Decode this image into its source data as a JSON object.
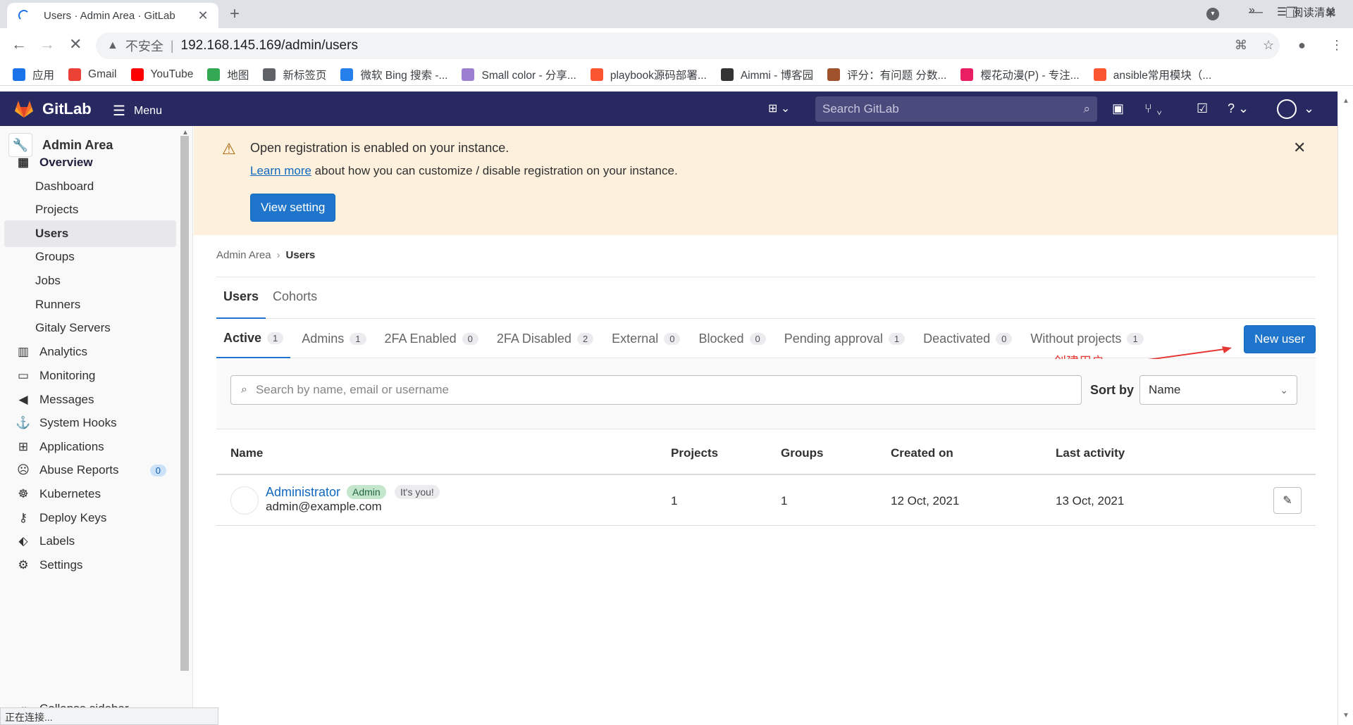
{
  "browser": {
    "tab_title": "Users · Admin Area · GitLab",
    "address_warning": "不安全",
    "url": "192.168.145.169/admin/users",
    "bookmarks": [
      {
        "label": "应用",
        "icon": "apps-grid-icon",
        "color": "#1a73e8"
      },
      {
        "label": "Gmail",
        "icon": "gmail-icon",
        "color": "#ea4335"
      },
      {
        "label": "YouTube",
        "icon": "youtube-icon",
        "color": "#ff0000"
      },
      {
        "label": "地图",
        "icon": "maps-icon",
        "color": "#34a853"
      },
      {
        "label": "新标签页",
        "icon": "globe-icon",
        "color": "#5f6368"
      },
      {
        "label": "微软 Bing 搜索 -...",
        "icon": "bing-icon",
        "color": "#2680eb"
      },
      {
        "label": "Small color - 分享...",
        "icon": "smallcolor-icon",
        "color": "#9c7fd1"
      },
      {
        "label": "playbook源码部署...",
        "icon": "csdn-icon",
        "color": "#fc5531"
      },
      {
        "label": "Aimmi - 博客园",
        "icon": "blog-icon",
        "color": "#333333"
      },
      {
        "label": "评分：有问题 分数...",
        "icon": "avatar-icon",
        "color": "#a0522d"
      },
      {
        "label": "樱花动漫(P) - 专注...",
        "icon": "flower-icon",
        "color": "#e91e63"
      },
      {
        "label": "ansible常用模块（...",
        "icon": "csdn-icon",
        "color": "#fc5531"
      }
    ],
    "bookmarks_more": "»",
    "reading_list": "阅读清单",
    "status_text": "正在连接..."
  },
  "header": {
    "brand": "GitLab",
    "menu_label": "Menu",
    "search_placeholder": "Search GitLab"
  },
  "sidebar": {
    "title": "Admin Area",
    "items": [
      {
        "label": "Overview",
        "icon": "overview-grid-icon",
        "kind": "group"
      },
      {
        "label": "Dashboard",
        "kind": "sub"
      },
      {
        "label": "Projects",
        "kind": "sub"
      },
      {
        "label": "Users",
        "kind": "sub-active"
      },
      {
        "label": "Groups",
        "kind": "sub"
      },
      {
        "label": "Jobs",
        "kind": "sub"
      },
      {
        "label": "Runners",
        "kind": "sub"
      },
      {
        "label": "Gitaly Servers",
        "kind": "sub"
      },
      {
        "label": "Analytics",
        "icon": "chart-icon",
        "kind": "item"
      },
      {
        "label": "Monitoring",
        "icon": "monitor-icon",
        "kind": "item"
      },
      {
        "label": "Messages",
        "icon": "megaphone-icon",
        "kind": "item"
      },
      {
        "label": "System Hooks",
        "icon": "hook-icon",
        "kind": "item"
      },
      {
        "label": "Applications",
        "icon": "applications-icon",
        "kind": "item"
      },
      {
        "label": "Abuse Reports",
        "icon": "abuse-icon",
        "kind": "item",
        "badge": "0"
      },
      {
        "label": "Kubernetes",
        "icon": "kubernetes-icon",
        "kind": "item"
      },
      {
        "label": "Deploy Keys",
        "icon": "key-icon",
        "kind": "item"
      },
      {
        "label": "Labels",
        "icon": "label-icon",
        "kind": "item"
      },
      {
        "label": "Settings",
        "icon": "settings-icon",
        "kind": "item"
      }
    ],
    "collapse_label": "Collapse sidebar"
  },
  "alert": {
    "title": "Open registration is enabled on your instance.",
    "link_text": "Learn more",
    "body": " about how you can customize / disable registration on your instance.",
    "button": "View setting"
  },
  "breadcrumb": {
    "parent": "Admin Area",
    "current": "Users"
  },
  "top_tabs": [
    {
      "label": "Users",
      "active": true
    },
    {
      "label": "Cohorts",
      "active": false
    }
  ],
  "filter_tabs": [
    {
      "label": "Active",
      "count": "1",
      "active": true
    },
    {
      "label": "Admins",
      "count": "1"
    },
    {
      "label": "2FA Enabled",
      "count": "0"
    },
    {
      "label": "2FA Disabled",
      "count": "2"
    },
    {
      "label": "External",
      "count": "0"
    },
    {
      "label": "Blocked",
      "count": "0"
    },
    {
      "label": "Pending approval",
      "count": "1"
    },
    {
      "label": "Deactivated",
      "count": "0"
    },
    {
      "label": "Without projects",
      "count": "1"
    }
  ],
  "new_user_button": "New user",
  "annotation": "创建用户",
  "search": {
    "placeholder": "Search by name, email or username"
  },
  "sort": {
    "label": "Sort by",
    "value": "Name"
  },
  "table": {
    "columns": [
      "Name",
      "Projects",
      "Groups",
      "Created on",
      "Last activity"
    ],
    "rows": [
      {
        "name": "Administrator",
        "badge_admin": "Admin",
        "badge_you": "It's you!",
        "email": "admin@example.com",
        "projects": "1",
        "groups": "1",
        "created_on": "12 Oct, 2021",
        "last_activity": "13 Oct, 2021"
      }
    ]
  },
  "colors": {
    "header_bg": "#292961",
    "primary": "#1f75cb",
    "alert_bg": "#fdf1dd",
    "annotation": "#e53935"
  }
}
